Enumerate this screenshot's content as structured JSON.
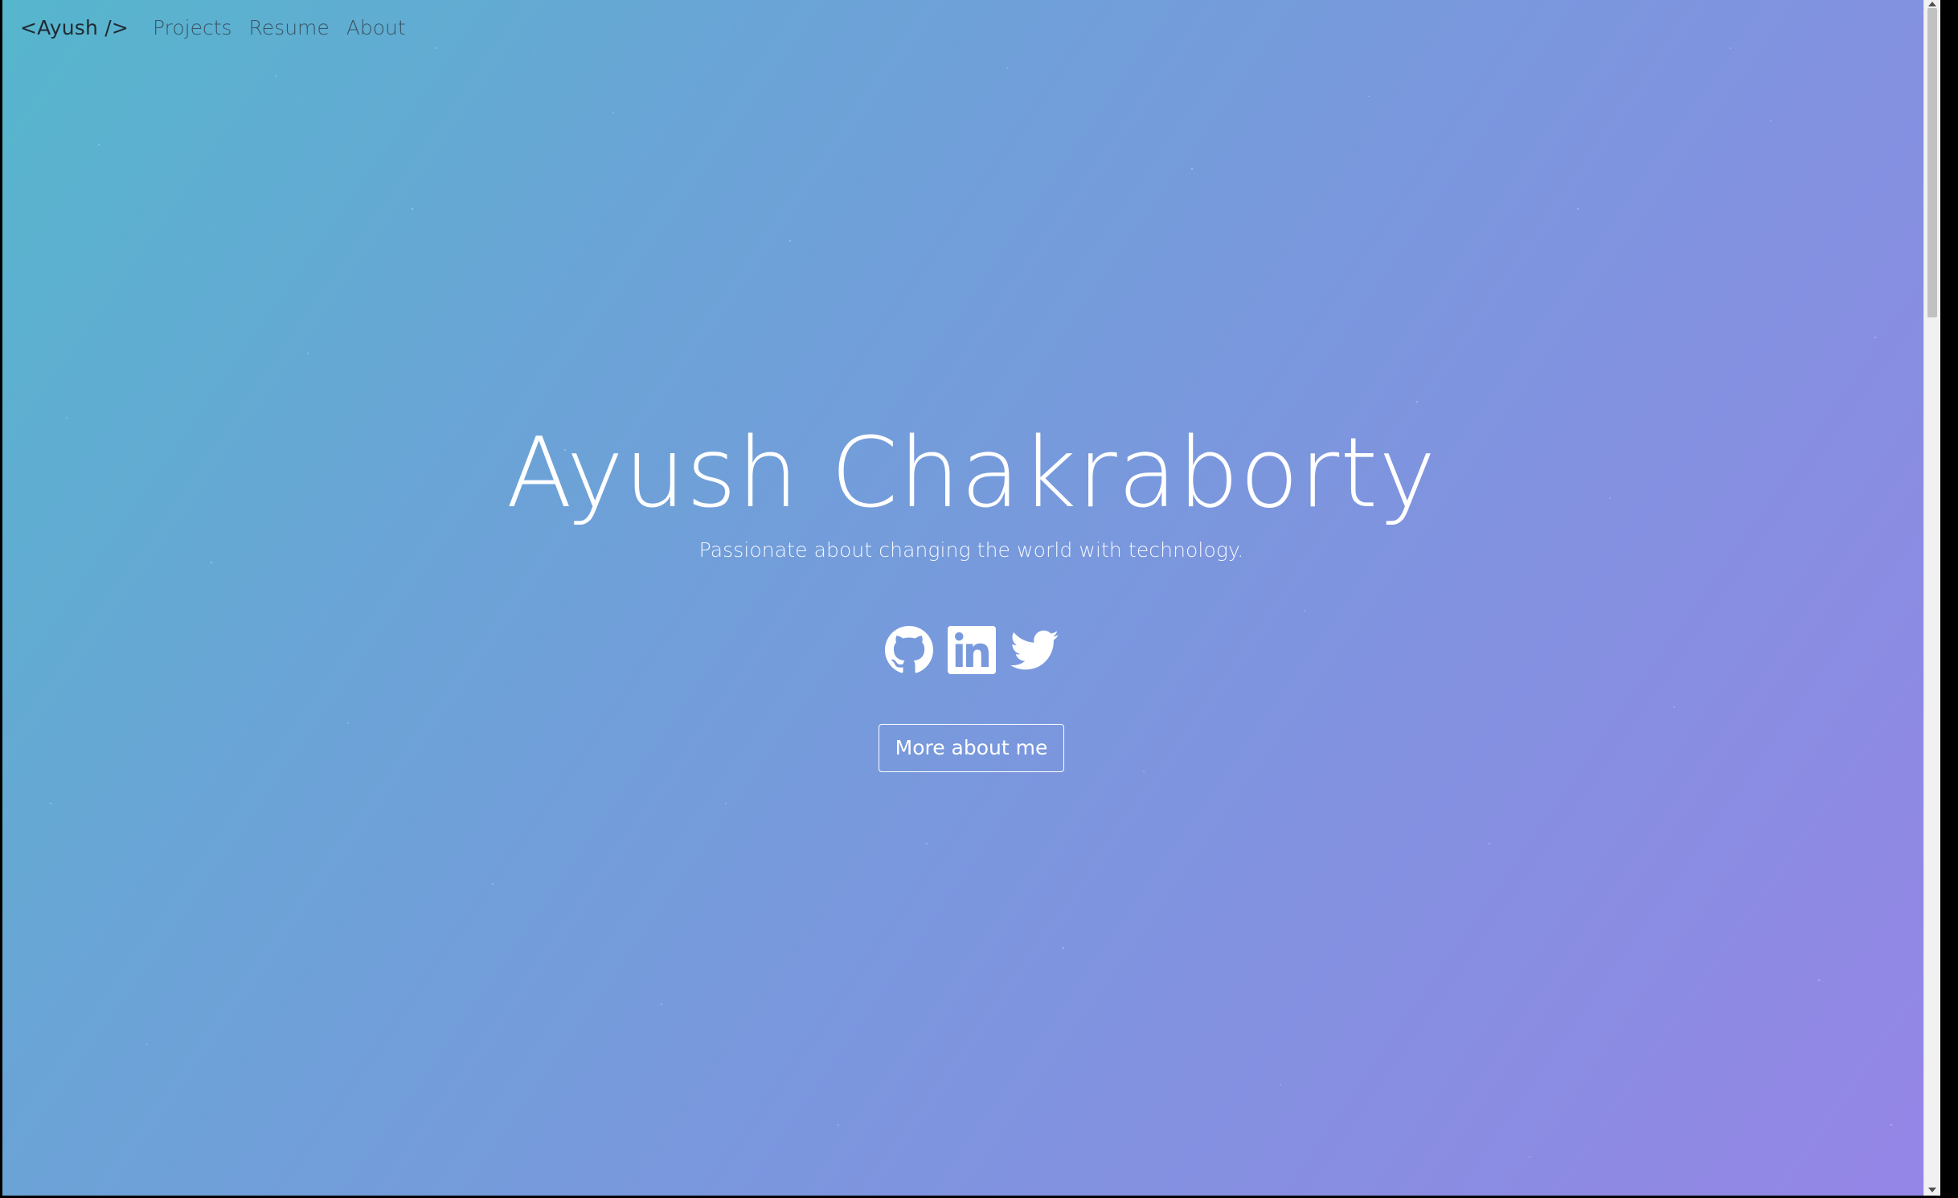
{
  "nav": {
    "brand": "<Ayush />",
    "links": [
      {
        "label": "Projects"
      },
      {
        "label": "Resume"
      },
      {
        "label": "About"
      }
    ]
  },
  "hero": {
    "title": "Ayush Chakraborty",
    "tagline": "Passionate about changing the world with technology.",
    "social": [
      {
        "icon": "github-icon"
      },
      {
        "icon": "linkedin-icon"
      },
      {
        "icon": "twitter-icon"
      }
    ],
    "cta_label": "More about me"
  },
  "colors": {
    "gradient_start": "#56b6cd",
    "gradient_end": "#9585e6",
    "text": "#ffffff",
    "brand_text": "#212a33",
    "nav_link": "#3a5566"
  }
}
